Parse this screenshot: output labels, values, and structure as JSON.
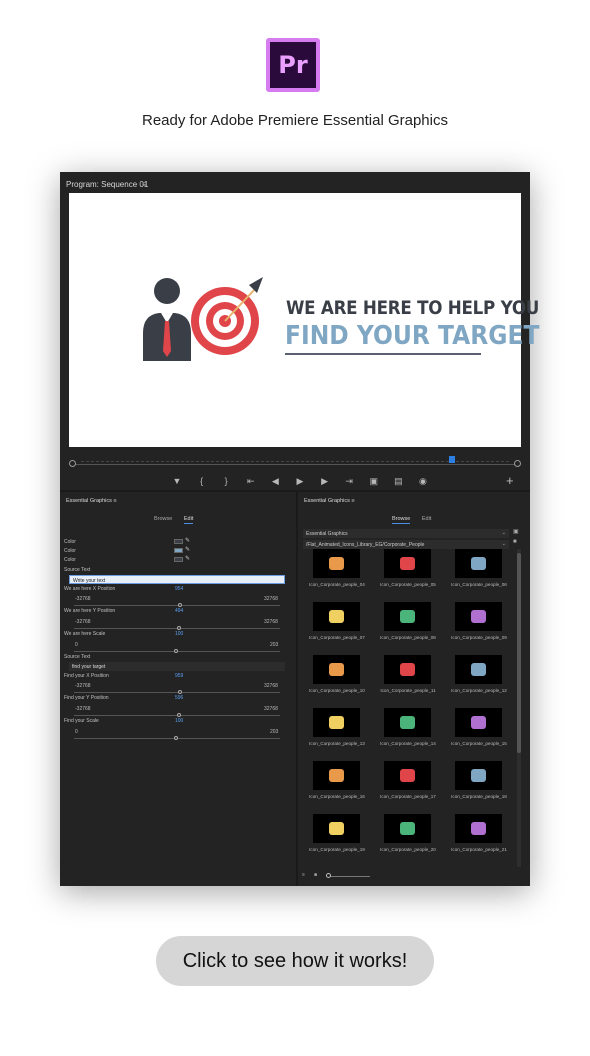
{
  "logo": {
    "text": "Pr",
    "brand_color": "#d67cf0"
  },
  "headline": "Ready for Adobe Premiere Essential Graphics",
  "monitor": {
    "title": "Program: Sequence 01",
    "menu_icon": "hamburger-icon",
    "viewer": {
      "line1": "WE ARE HERE TO HELP YOU",
      "line2": "FIND YOUR TARGET",
      "line1_color": "#3a3f47",
      "line2_color": "#7fa6c2",
      "target_color": "#e0454a"
    },
    "transport": [
      "marker-icon",
      "mark-in-icon",
      "mark-out-icon",
      "go-to-in-icon",
      "step-back-icon",
      "play-icon",
      "step-forward-icon",
      "go-to-out-icon",
      "lift-icon",
      "extract-icon",
      "camera-icon"
    ],
    "add_button": "+"
  },
  "left_panel": {
    "title": "Essential Graphics",
    "tabs": [
      "Browse",
      "Edit"
    ],
    "active_tab": "Edit",
    "colors": [
      {
        "label": "Color",
        "swatch": "#3a3f47"
      },
      {
        "label": "Color",
        "swatch": "#7fa6c2"
      },
      {
        "label": "Color",
        "swatch": "#3a3f47"
      }
    ],
    "source_text_1": {
      "label": "Source Text",
      "value": "Write your text"
    },
    "x_pos_1": {
      "label": "We are here X Position",
      "value": "954",
      "min": "-32768",
      "max": "32768"
    },
    "y_pos_1": {
      "label": "We are here Y Position",
      "value": "494",
      "min": "-32768",
      "max": "32768"
    },
    "scale_1": {
      "label": "We are here Scale",
      "value": "100",
      "min": "0",
      "max": "203"
    },
    "source_text_2": {
      "label": "Source Text",
      "value": "find your target"
    },
    "x_pos_2": {
      "label": "Find your X Position",
      "value": "959",
      "min": "-32768",
      "max": "32768"
    },
    "y_pos_2": {
      "label": "Find your Y Position",
      "value": "596",
      "min": "-32768",
      "max": "32768"
    },
    "scale_2": {
      "label": "Find your Scale",
      "value": "100",
      "min": "0",
      "max": "203"
    }
  },
  "right_panel": {
    "title": "Essential Graphics",
    "tabs": [
      "Browse",
      "Edit"
    ],
    "active_tab": "Browse",
    "library": "Essential Graphics",
    "path": "/Flat_Animated_Icons_Library_EG/Corporate_People",
    "items": [
      "Icon_Corporate_people_04",
      "Icon_Corporate_people_05",
      "Icon_Corporate_people_06",
      "Icon_Corporate_people_07",
      "Icon_Corporate_people_08",
      "Icon_Corporate_people_09",
      "Icon_Corporate_people_10",
      "Icon_Corporate_people_11",
      "Icon_Corporate_people_12",
      "Icon_Corporate_people_13",
      "Icon_Corporate_people_14",
      "Icon_Corporate_people_15",
      "Icon_Corporate_people_16",
      "Icon_Corporate_people_17",
      "Icon_Corporate_people_18",
      "Icon_Corporate_people_19",
      "Icon_Corporate_people_20",
      "Icon_Corporate_people_21"
    ]
  },
  "cta": "Click to see how it works!"
}
